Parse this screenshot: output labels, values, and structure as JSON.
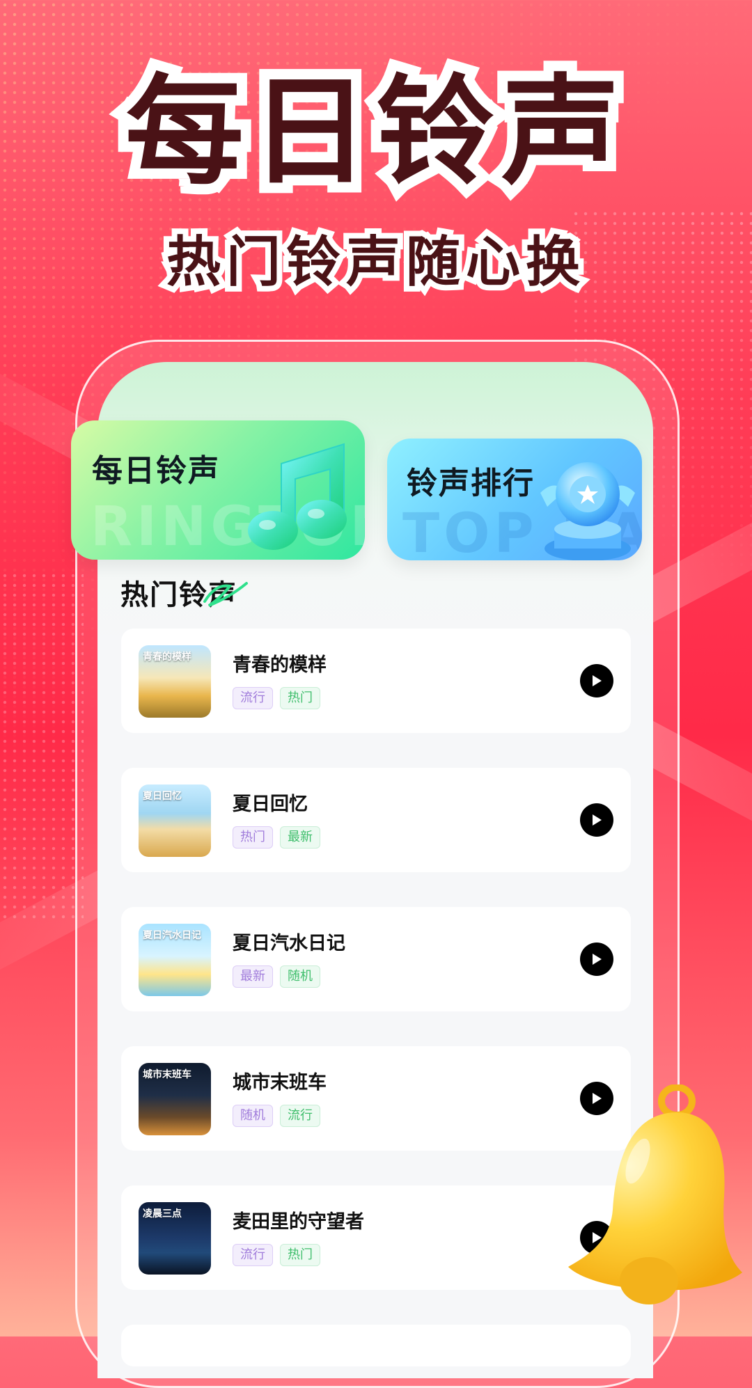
{
  "hero": {
    "title": "每日铃声",
    "subtitle": "热门铃声随心换"
  },
  "cards": {
    "daily": {
      "title": "每日铃声",
      "watermark": "RINGTONE",
      "icon": "music-note-icon"
    },
    "rank": {
      "title": "铃声排行",
      "watermark": "TOP RANK",
      "icon": "trophy-icon"
    }
  },
  "section": {
    "title": "热门铃声"
  },
  "songs": [
    {
      "title": "青春的模样",
      "cover_text": "青春的模样",
      "tags": [
        "流行",
        "热门"
      ]
    },
    {
      "title": "夏日回忆",
      "cover_text": "夏日回忆",
      "tags": [
        "热门",
        "最新"
      ]
    },
    {
      "title": "夏日汽水日记",
      "cover_text": "夏日汽水日记",
      "tags": [
        "最新",
        "随机"
      ]
    },
    {
      "title": "城市末班车",
      "cover_text": "城市末班车",
      "tags": [
        "随机",
        "流行"
      ]
    },
    {
      "title": "麦田里的守望者",
      "cover_text": "凌晨三点",
      "tags": [
        "流行",
        "热门"
      ]
    }
  ],
  "colors": {
    "accent_red": "#ff3c56",
    "title_dark": "#4a1216",
    "tag_purple": "#a17ddb",
    "tag_green": "#3fbe6c"
  },
  "decorations": {
    "bell": "bell-icon",
    "play": "play-icon"
  }
}
